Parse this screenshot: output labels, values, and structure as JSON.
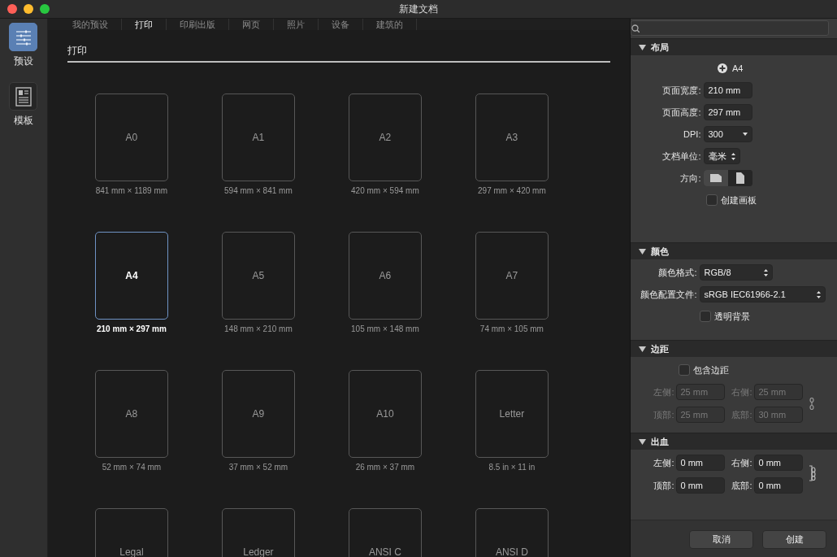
{
  "window": {
    "title": "新建文档"
  },
  "sidebar": {
    "items": [
      {
        "label": "预设",
        "kind": "presets",
        "selected": true
      },
      {
        "label": "模板",
        "kind": "templates",
        "selected": false
      }
    ]
  },
  "tabs": [
    {
      "label": "我的预设",
      "selected": false
    },
    {
      "label": "打印",
      "selected": true
    },
    {
      "label": "印刷出版",
      "selected": false
    },
    {
      "label": "网页",
      "selected": false
    },
    {
      "label": "照片",
      "selected": false
    },
    {
      "label": "设备",
      "selected": false
    },
    {
      "label": "建筑的",
      "selected": false
    }
  ],
  "section_title": "打印",
  "presets": [
    {
      "name": "A0",
      "size": "841 mm × 1189 mm",
      "selected": false
    },
    {
      "name": "A1",
      "size": "594 mm × 841 mm",
      "selected": false
    },
    {
      "name": "A2",
      "size": "420 mm × 594 mm",
      "selected": false
    },
    {
      "name": "A3",
      "size": "297 mm × 420 mm",
      "selected": false
    },
    {
      "name": "A4",
      "size": "210 mm × 297 mm",
      "selected": true
    },
    {
      "name": "A5",
      "size": "148 mm × 210 mm",
      "selected": false
    },
    {
      "name": "A6",
      "size": "105 mm × 148 mm",
      "selected": false
    },
    {
      "name": "A7",
      "size": "74 mm × 105 mm",
      "selected": false
    },
    {
      "name": "A8",
      "size": "52 mm × 74 mm",
      "selected": false
    },
    {
      "name": "A9",
      "size": "37 mm × 52 mm",
      "selected": false
    },
    {
      "name": "A10",
      "size": "26 mm × 37 mm",
      "selected": false
    },
    {
      "name": "Letter",
      "size": "8.5 in × 11 in",
      "selected": false
    },
    {
      "name": "Legal",
      "selected": false
    },
    {
      "name": "Ledger",
      "selected": false
    },
    {
      "name": "ANSI C",
      "selected": false
    },
    {
      "name": "ANSI D",
      "selected": false
    }
  ],
  "layout": {
    "title": "布局",
    "expanded": true,
    "preset": "A4",
    "fields": [
      {
        "label": "页面宽度:",
        "value": "210 mm",
        "kind": "text"
      },
      {
        "label": "页面高度:",
        "value": "297 mm",
        "kind": "text"
      },
      {
        "label": "DPI:",
        "value": "300",
        "kind": "dropdown"
      },
      {
        "label": "文档单位:",
        "value": "毫米",
        "kind": "stepper"
      }
    ],
    "orientation": {
      "label": "方向:",
      "options": [
        {
          "kind": "landscape",
          "selected": false
        },
        {
          "kind": "portrait",
          "selected": true
        }
      ]
    },
    "artboard": {
      "label": "创建画板",
      "checked": false
    }
  },
  "color": {
    "title": "颜色",
    "expanded": true,
    "fields": [
      {
        "label": "颜色格式:",
        "value": "RGB/8",
        "kind": "stepper"
      },
      {
        "label": "颜色配置文件:",
        "value": "sRGB IEC61966-2.1",
        "kind": "stepper"
      }
    ],
    "transparent": {
      "label": "透明背景",
      "checked": false
    }
  },
  "margins": {
    "title": "边距",
    "expanded": true,
    "include": {
      "label": "包含边距",
      "checked": false
    },
    "disabled": true,
    "linked": false,
    "fields": [
      {
        "label": "左侧:",
        "value": "25 mm"
      },
      {
        "label": "右侧:",
        "value": "25 mm"
      },
      {
        "label": "顶部:",
        "value": "25 mm"
      },
      {
        "label": "底部:",
        "value": "30 mm"
      }
    ]
  },
  "bleed": {
    "title": "出血",
    "expanded": true,
    "disabled": false,
    "linked": true,
    "fields": [
      {
        "label": "左侧:",
        "value": "0 mm"
      },
      {
        "label": "右侧:",
        "value": "0 mm"
      },
      {
        "label": "顶部:",
        "value": "0 mm"
      },
      {
        "label": "底部:",
        "value": "0 mm"
      }
    ]
  },
  "buttons": [
    {
      "label": "取消"
    },
    {
      "label": "创建"
    }
  ]
}
